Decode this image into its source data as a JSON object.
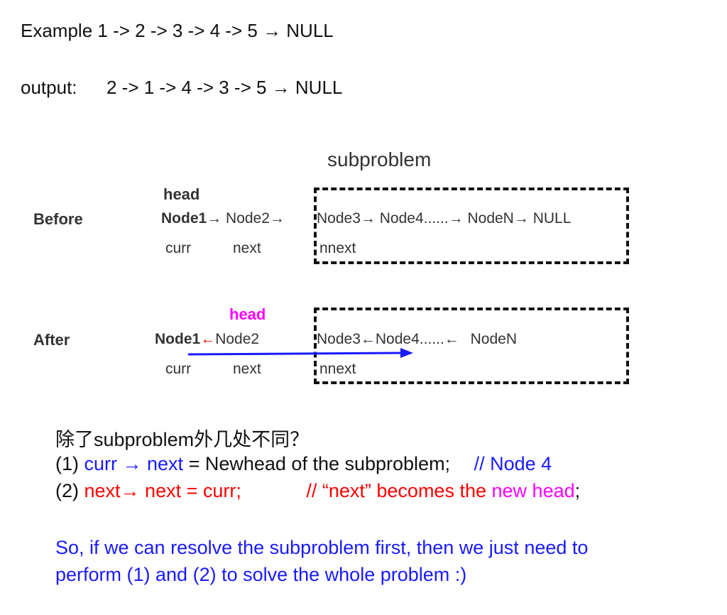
{
  "example_line": "Example 1 -> 2 -> 3 -> 4 -> 5 → NULL",
  "output_label": "output:",
  "output_value": "2 -> 1 -> 4 -> 3 -> 5 → NULL",
  "subproblem_title": "subproblem",
  "before": {
    "label": "Before",
    "head": "head",
    "node1": "Node1",
    "arrow1": "→",
    "node2": "Node2",
    "arrow2": "→",
    "node3": "Node3",
    "arrow3": "→",
    "node4": "Node4......",
    "arrow4": "→",
    "nodeN": "NodeN",
    "arrow5": "→",
    "null": "NULL",
    "curr": "curr",
    "next": "next",
    "nnext": "nnext"
  },
  "after": {
    "label": "After",
    "head": "head",
    "node1": "Node1",
    "arrow1": "←",
    "node2": "Node2",
    "node3": "Node3",
    "arrow3": "←",
    "node4": "Node4......",
    "arrow4": "←",
    "nodeN": "NodeN",
    "curr": "curr",
    "next": "next",
    "nnext": "nnext"
  },
  "notes": {
    "question": "除了subproblem外几处不同？",
    "l1_num": "(1)",
    "l1_colored": "curr → next",
    "l1_rest": "= Newhead of the subproblem;",
    "l1_comment": "// Node 4",
    "l2_num": "(2)",
    "l2_colored": "next→ next = curr;",
    "l2_comment_a": "// “next” becomes the",
    "l2_comment_b": "new head",
    "l2_end": ";",
    "summary_1": "So, if we can resolve the subproblem first, then we just need to",
    "summary_2": "perform (1) and (2) to solve the whole problem :)"
  },
  "colors": {
    "magenta": "#ff00ff",
    "red": "#ff0000",
    "blue": "#1a1aff"
  }
}
